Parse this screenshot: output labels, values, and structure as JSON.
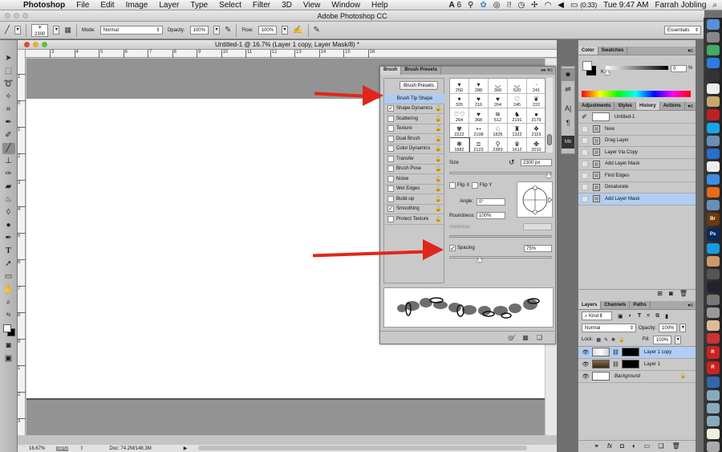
{
  "menubar": {
    "app": "Photoshop",
    "items": [
      "File",
      "Edit",
      "Image",
      "Layer",
      "Type",
      "Select",
      "Filter",
      "3D",
      "View",
      "Window",
      "Help"
    ],
    "status_items": {
      "adobe_badge": "6",
      "battery": "(0:33)",
      "clock": "Tue 9:47 AM",
      "user": "Farrah Jobling"
    }
  },
  "window": {
    "title": "Adobe Photoshop CC"
  },
  "options_bar": {
    "brush_size": "2300",
    "mode_label": "Mode:",
    "mode_value": "Normal",
    "opacity_label": "Opacity:",
    "opacity_value": "100%",
    "flow_label": "Flow:",
    "flow_value": "100%",
    "workspace": "Essentials"
  },
  "document": {
    "title": "Untitled-1 @ 16.7% (Layer 1 copy, Layer Mask/8) *",
    "ruler_h": [
      "3",
      "4",
      "5",
      "6",
      "7",
      "8",
      "9",
      "10",
      "11",
      "12",
      "13",
      "14",
      "15",
      "16"
    ],
    "ruler_v": [
      "1",
      "0",
      "1",
      "2",
      "3",
      "4",
      "5",
      "6",
      "7",
      "8",
      "9",
      "1",
      "2",
      "3"
    ],
    "zoom": "16.67%",
    "doc_size": "Doc: 74.2M/148.3M"
  },
  "brush_panel": {
    "tabs": [
      "Brush",
      "Brush Presets"
    ],
    "presets_button": "Brush Presets",
    "options": [
      {
        "label": "Brush Tip Shape",
        "selected": true,
        "checkbox": false
      },
      {
        "label": "Shape Dynamics",
        "checked": true
      },
      {
        "label": "Scattering",
        "checked": false
      },
      {
        "label": "Texture",
        "checked": false
      },
      {
        "label": "Dual Brush",
        "checked": false
      },
      {
        "label": "Color Dynamics",
        "checked": false
      },
      {
        "label": "Transfer",
        "checked": false
      },
      {
        "label": "Brush Pose",
        "checked": false
      },
      {
        "label": "Noise",
        "checked": false
      },
      {
        "label": "Wet Edges",
        "checked": false
      },
      {
        "label": "Build-up",
        "checked": false
      },
      {
        "label": "Smoothing",
        "checked": true
      },
      {
        "label": "Protect Texture",
        "checked": false
      }
    ],
    "tips": [
      {
        "size": "250",
        "g": "▾"
      },
      {
        "size": "288",
        "g": "▾"
      },
      {
        "size": "300",
        "g": "◡"
      },
      {
        "size": "520",
        "g": "◡"
      },
      {
        "size": "241",
        "g": "·"
      },
      {
        "size": "320",
        "g": "✦"
      },
      {
        "size": "216",
        "g": "♥"
      },
      {
        "size": "264",
        "g": "♥"
      },
      {
        "size": "245",
        "g": "♡"
      },
      {
        "size": "222",
        "g": "❦"
      },
      {
        "size": "264",
        "g": "♡♡"
      },
      {
        "size": "368",
        "g": "♥"
      },
      {
        "size": "512",
        "g": "≋"
      },
      {
        "size": "2191",
        "g": "♞"
      },
      {
        "size": "2179",
        "g": "●"
      },
      {
        "size": "2222",
        "g": "✾"
      },
      {
        "size": "2108",
        "g": "➳"
      },
      {
        "size": "1826",
        "g": "♘"
      },
      {
        "size": "1322",
        "g": "♜"
      },
      {
        "size": "2115",
        "g": "❖"
      },
      {
        "size": "1882",
        "g": "❃",
        "selected": true
      },
      {
        "size": "2123",
        "g": "≣"
      },
      {
        "size": "2383",
        "g": "⚲"
      },
      {
        "size": "1612",
        "g": "♛"
      },
      {
        "size": "2010",
        "g": "✤"
      }
    ],
    "size_label": "Size",
    "size_value": "2300 px",
    "flip_x": "Flip X",
    "flip_y": "Flip Y",
    "angle_label": "Angle:",
    "angle_value": "0°",
    "roundness_label": "Roundness:",
    "roundness_value": "100%",
    "hardness_label": "Hardness",
    "spacing_label": "Spacing",
    "spacing_checked": true,
    "spacing_value": "75%",
    "size_slider_fraction": 0.97,
    "spacing_slider_fraction": 0.3
  },
  "color_panel": {
    "tabs": [
      "Color",
      "Swatches"
    ],
    "channel": "K",
    "value": "0",
    "unit": "%"
  },
  "history_panel": {
    "tabs": [
      "Adjustments",
      "Styles",
      "History",
      "Actions"
    ],
    "snapshot": "Untitled-1",
    "states": [
      "New",
      "Drag Layer",
      "Layer Via Copy",
      "Add Layer Mask",
      "Find Edges",
      "Desaturate",
      "Add Layer Mask"
    ],
    "selected_index": 6
  },
  "layers_panel": {
    "tabs": [
      "Layers",
      "Channels",
      "Paths"
    ],
    "filter": "Kind",
    "blend_mode": "Normal",
    "opacity_label": "Opacity:",
    "opacity_value": "100%",
    "lock_label": "Lock:",
    "fill_label": "Fill:",
    "fill_value": "100%",
    "layers": [
      {
        "name": "Layer 1 copy",
        "selected": true,
        "mask": true
      },
      {
        "name": "Layer 1",
        "selected": false,
        "mask": true
      },
      {
        "name": "Background",
        "selected": false,
        "locked": true
      }
    ]
  },
  "dock": [
    "Finder",
    "Launchpad",
    "Mission Control",
    "App Store",
    "Dashboard",
    "Calendar",
    "Contacts",
    "Acrobat",
    "Skype",
    "iPhoto",
    "iTunes",
    "Preview",
    "Safari",
    "Firefox",
    "Image Capture",
    "Br",
    "Ps",
    "blurb",
    "Photo Booth",
    "Time Machine",
    "FaceTime",
    "Screenshot",
    "Grab",
    "Stickies",
    "Dictionary",
    "R",
    "R",
    "Migration",
    "Folder",
    "Folder",
    "Folder",
    "Document",
    "Trash"
  ],
  "colors": {
    "selection": "#aecbf2",
    "arrow": "#e0261a"
  }
}
